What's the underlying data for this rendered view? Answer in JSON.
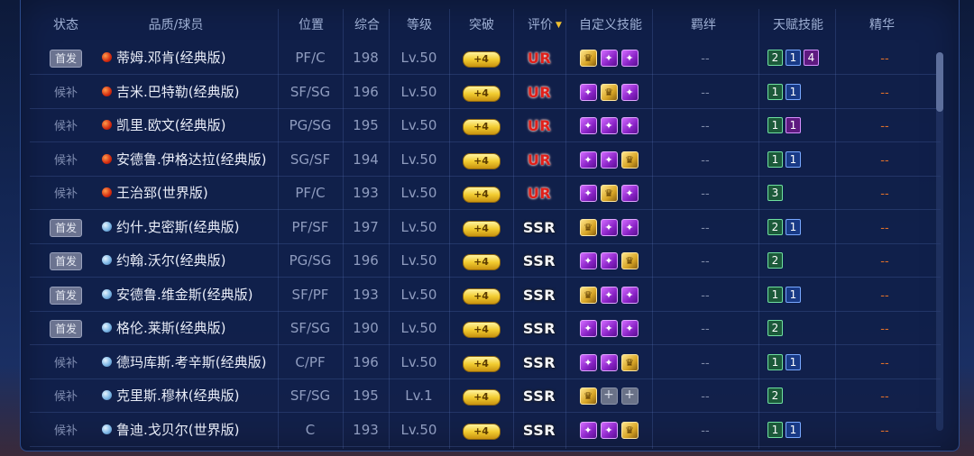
{
  "headers": {
    "status": "状态",
    "player": "品质/球员",
    "position": "位置",
    "overall": "综合",
    "level": "等级",
    "breakthrough": "突破",
    "rating": "评价",
    "custom_skills": "自定义技能",
    "bond": "羁绊",
    "talent": "天赋技能",
    "essence": "精华"
  },
  "icons": {
    "rating_sort": "sort-down-arrow",
    "skill_purple": "purple-skill-badge",
    "skill_gold": "gold-skill-badge"
  },
  "colors": {
    "ur": "#e0201a",
    "ssr": "#f4f6fb",
    "starter_badge": "#6b7390",
    "accent_gold": "#f2cc30"
  },
  "rows": [
    {
      "status": "首发",
      "starter": true,
      "quality": "red",
      "name": "蒂姆.邓肯(经典版)",
      "position": "PF/C",
      "overall": "198",
      "level": "Lv.50",
      "break": "+4",
      "rating": "UR",
      "skills": [
        "gold",
        "purple",
        "purple"
      ],
      "talents": [
        {
          "v": "2",
          "c": "green"
        },
        {
          "v": "1",
          "c": "blue"
        },
        {
          "v": "4",
          "c": "purple"
        }
      ],
      "bond": "--",
      "essence": "--"
    },
    {
      "status": "候补",
      "starter": false,
      "quality": "red",
      "name": "吉米.巴特勒(经典版)",
      "position": "SF/SG",
      "overall": "196",
      "level": "Lv.50",
      "break": "+4",
      "rating": "UR",
      "skills": [
        "purple",
        "gold",
        "purple"
      ],
      "talents": [
        {
          "v": "1",
          "c": "green"
        },
        {
          "v": "1",
          "c": "blue"
        }
      ],
      "bond": "--",
      "essence": "--"
    },
    {
      "status": "候补",
      "starter": false,
      "quality": "red",
      "name": "凯里.欧文(经典版)",
      "position": "PG/SG",
      "overall": "195",
      "level": "Lv.50",
      "break": "+4",
      "rating": "UR",
      "skills": [
        "purple",
        "purple",
        "purple"
      ],
      "talents": [
        {
          "v": "1",
          "c": "green"
        },
        {
          "v": "1",
          "c": "purple"
        }
      ],
      "bond": "--",
      "essence": "--"
    },
    {
      "status": "候补",
      "starter": false,
      "quality": "red",
      "name": "安德鲁.伊格达拉(经典版)",
      "position": "SG/SF",
      "overall": "194",
      "level": "Lv.50",
      "break": "+4",
      "rating": "UR",
      "skills": [
        "purple",
        "purple",
        "gold"
      ],
      "talents": [
        {
          "v": "1",
          "c": "green"
        },
        {
          "v": "1",
          "c": "blue"
        }
      ],
      "bond": "--",
      "essence": "--"
    },
    {
      "status": "候补",
      "starter": false,
      "quality": "red",
      "name": "王治郅(世界版)",
      "position": "PF/C",
      "overall": "193",
      "level": "Lv.50",
      "break": "+4",
      "rating": "UR",
      "skills": [
        "purple",
        "gold",
        "purple"
      ],
      "talents": [
        {
          "v": "3",
          "c": "green"
        }
      ],
      "bond": "--",
      "essence": "--"
    },
    {
      "status": "首发",
      "starter": true,
      "quality": "blue",
      "name": "约什.史密斯(经典版)",
      "position": "PF/SF",
      "overall": "197",
      "level": "Lv.50",
      "break": "+4",
      "rating": "SSR",
      "skills": [
        "gold",
        "purple",
        "purple"
      ],
      "talents": [
        {
          "v": "2",
          "c": "green"
        },
        {
          "v": "1",
          "c": "blue"
        }
      ],
      "bond": "--",
      "essence": "--"
    },
    {
      "status": "首发",
      "starter": true,
      "quality": "blue",
      "name": "约翰.沃尔(经典版)",
      "position": "PG/SG",
      "overall": "196",
      "level": "Lv.50",
      "break": "+4",
      "rating": "SSR",
      "skills": [
        "purple",
        "purple",
        "gold"
      ],
      "talents": [
        {
          "v": "2",
          "c": "green"
        }
      ],
      "bond": "--",
      "essence": "--"
    },
    {
      "status": "首发",
      "starter": true,
      "quality": "blue",
      "name": "安德鲁.维金斯(经典版)",
      "position": "SF/PF",
      "overall": "193",
      "level": "Lv.50",
      "break": "+4",
      "rating": "SSR",
      "skills": [
        "gold",
        "purple",
        "purple"
      ],
      "talents": [
        {
          "v": "1",
          "c": "green"
        },
        {
          "v": "1",
          "c": "blue"
        }
      ],
      "bond": "--",
      "essence": "--"
    },
    {
      "status": "首发",
      "starter": true,
      "quality": "blue",
      "name": "格伦.莱斯(经典版)",
      "position": "SF/SG",
      "overall": "190",
      "level": "Lv.50",
      "break": "+4",
      "rating": "SSR",
      "skills": [
        "purple",
        "purple",
        "purple"
      ],
      "talents": [
        {
          "v": "2",
          "c": "green"
        }
      ],
      "bond": "--",
      "essence": "--"
    },
    {
      "status": "候补",
      "starter": false,
      "quality": "blue",
      "name": "德玛库斯.考辛斯(经典版)",
      "position": "C/PF",
      "overall": "196",
      "level": "Lv.50",
      "break": "+4",
      "rating": "SSR",
      "skills": [
        "purple",
        "purple",
        "gold"
      ],
      "talents": [
        {
          "v": "1",
          "c": "green"
        },
        {
          "v": "1",
          "c": "blue"
        }
      ],
      "bond": "--",
      "essence": "--"
    },
    {
      "status": "候补",
      "starter": false,
      "quality": "blue",
      "name": "克里斯.穆林(经典版)",
      "position": "SF/SG",
      "overall": "195",
      "level": "Lv.1",
      "break": "+4",
      "rating": "SSR",
      "skills": [
        "gold",
        "empty",
        "empty"
      ],
      "talents": [
        {
          "v": "2",
          "c": "green"
        }
      ],
      "bond": "--",
      "essence": "--"
    },
    {
      "status": "候补",
      "starter": false,
      "quality": "blue",
      "name": "鲁迪.戈贝尔(世界版)",
      "position": "C",
      "overall": "193",
      "level": "Lv.50",
      "break": "+4",
      "rating": "SSR",
      "skills": [
        "purple",
        "purple",
        "gold"
      ],
      "talents": [
        {
          "v": "1",
          "c": "green"
        },
        {
          "v": "1",
          "c": "blue"
        }
      ],
      "bond": "--",
      "essence": "--"
    }
  ]
}
